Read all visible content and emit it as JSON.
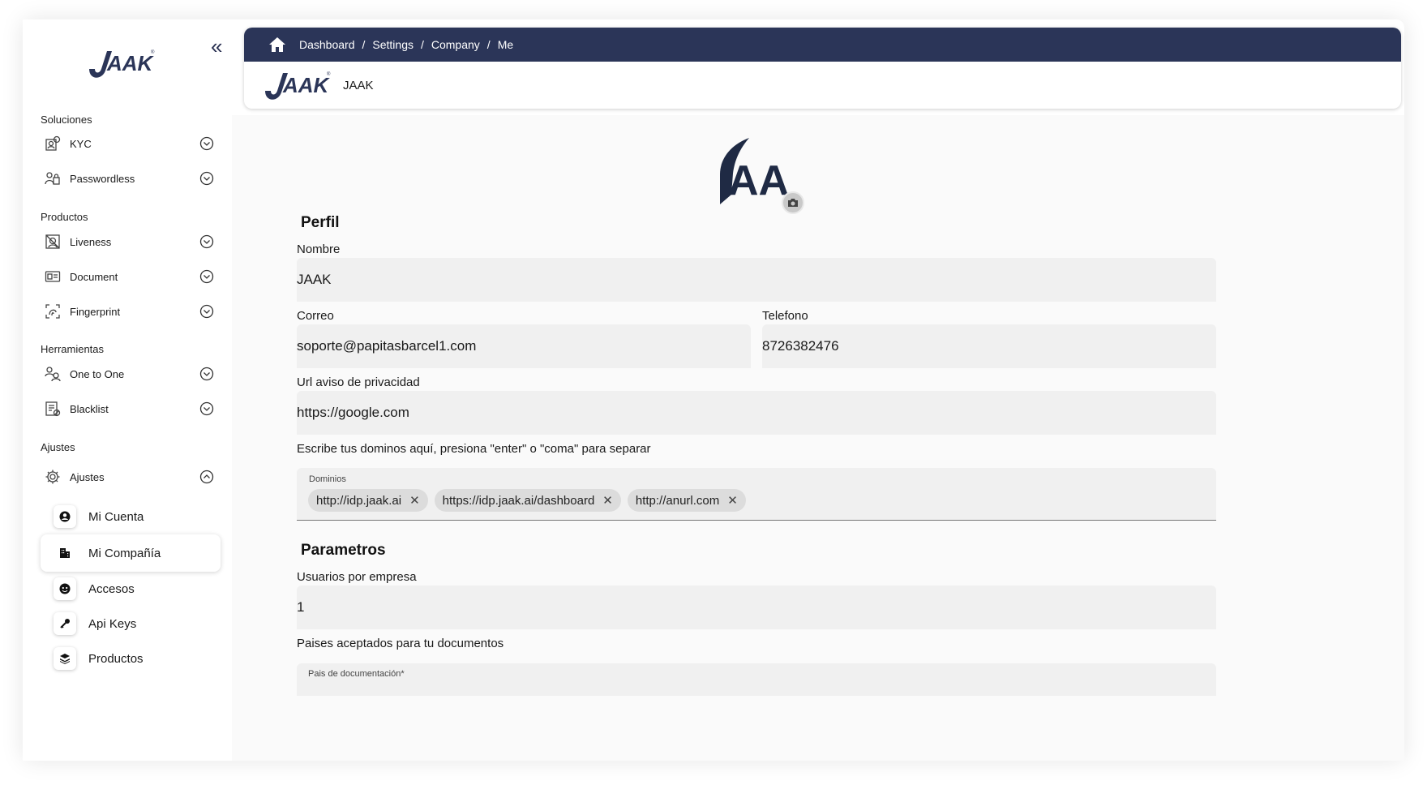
{
  "sidebar": {
    "logo_text": "JAAK",
    "sections": {
      "soluciones": "Soluciones",
      "productos": "Productos",
      "herramientas": "Herramientas",
      "ajustes": "Ajustes"
    },
    "items": {
      "kyc": "KYC",
      "passwordless": "Passwordless",
      "liveness": "Liveness",
      "document": "Document",
      "fingerprint": "Fingerprint",
      "one_to_one": "One to One",
      "blacklist": "Blacklist",
      "ajustes": "Ajustes"
    },
    "sub_items": {
      "mi_cuenta": "Mi Cuenta",
      "mi_compania": "Mi Compañía",
      "accesos": "Accesos",
      "api_keys": "Api Keys",
      "productos": "Productos"
    }
  },
  "header": {
    "breadcrumb": [
      "Dashboard",
      "Settings",
      "Company",
      "Me"
    ],
    "separator": "/",
    "brand_name": "JAAK",
    "brand_logo_text": "JAAK"
  },
  "profile": {
    "avatar_text": "AA",
    "title": "Perfil",
    "nombre_label": "Nombre",
    "nombre_value": "JAAK",
    "correo_label": "Correo",
    "correo_value": "soporte@papitasbarcel1.com",
    "telefono_label": "Telefono",
    "telefono_value": "8726382476",
    "url_label": "Url aviso de privacidad",
    "url_value": "https://google.com",
    "dominios_hint": "Escribe tus dominos aquí, presiona \"enter\" o \"coma\" para separar",
    "dominios_caption": "Dominios",
    "dominios": [
      "http://idp.jaak.ai",
      "https://idp.jaak.ai/dashboard",
      "http://anurl.com"
    ]
  },
  "parametros": {
    "title": "Parametros",
    "usuarios_label": "Usuarios por empresa",
    "usuarios_value": "1",
    "paises_label": "Paises aceptados para tu documentos",
    "pais_caption": "Pais de documentación*"
  },
  "colors": {
    "navy": "#2b3558",
    "field_bg": "#f0f0f0"
  }
}
